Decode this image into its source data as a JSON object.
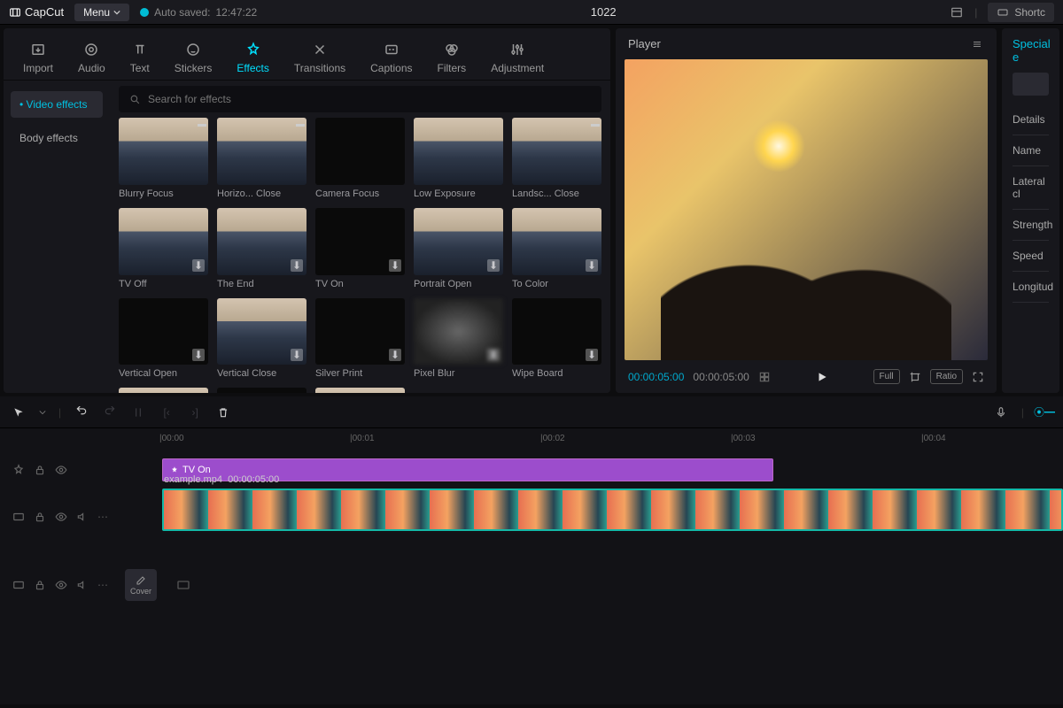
{
  "app": {
    "name": "CapCut",
    "menu": "Menu",
    "autosave_label": "Auto saved:",
    "autosave_time": "12:47:22",
    "project": "1022",
    "shortcut": "Shortc"
  },
  "tabs": {
    "import": "Import",
    "audio": "Audio",
    "text": "Text",
    "stickers": "Stickers",
    "effects": "Effects",
    "transitions": "Transitions",
    "captions": "Captions",
    "filters": "Filters",
    "adjustment": "Adjustment"
  },
  "sidebar": {
    "video_effects": "Video effects",
    "body_effects": "Body effects"
  },
  "search": {
    "placeholder": "Search for effects"
  },
  "effects": [
    {
      "name": "Blurry Focus",
      "thumb": "city",
      "close": true
    },
    {
      "name": "Horizo... Close",
      "thumb": "city",
      "close": true
    },
    {
      "name": "Camera Focus",
      "thumb": "dark"
    },
    {
      "name": "Low Exposure",
      "thumb": "city"
    },
    {
      "name": "Landsc... Close",
      "thumb": "city",
      "close": true
    },
    {
      "name": "TV Off",
      "thumb": "city",
      "dl": true
    },
    {
      "name": "The End",
      "thumb": "city",
      "dl": true
    },
    {
      "name": "TV On",
      "thumb": "dark",
      "dl": true
    },
    {
      "name": "Portrait Open",
      "thumb": "city",
      "dl": true
    },
    {
      "name": "To Color",
      "thumb": "city",
      "dl": true
    },
    {
      "name": "Vertical Open",
      "thumb": "dark",
      "dl": true
    },
    {
      "name": "Vertical Close",
      "thumb": "city",
      "dl": true
    },
    {
      "name": "Silver Print",
      "thumb": "dark",
      "dl": true
    },
    {
      "name": "Pixel Blur",
      "thumb": "blur",
      "dl": true
    },
    {
      "name": "Wipe Board",
      "thumb": "dark",
      "dl": true
    },
    {
      "name": "",
      "thumb": "city"
    },
    {
      "name": "",
      "thumb": "dark"
    },
    {
      "name": "",
      "thumb": "city"
    }
  ],
  "player": {
    "title": "Player",
    "current": "00:00:05:00",
    "total": "00:00:05:00",
    "full": "Full",
    "ratio": "Ratio"
  },
  "props": {
    "title": "Special e",
    "details": "Details",
    "name_label": "Name",
    "lateral": "Lateral cl",
    "strength": "Strength",
    "speed": "Speed",
    "longitude": "Longitud"
  },
  "timeline": {
    "ticks": [
      "00:00",
      "00:01",
      "00:02",
      "00:03",
      "00:04"
    ],
    "effect_clip": "TV On",
    "video_clip": "example.mp4",
    "video_tc": "00:00:05:00",
    "cover": "Cover"
  }
}
